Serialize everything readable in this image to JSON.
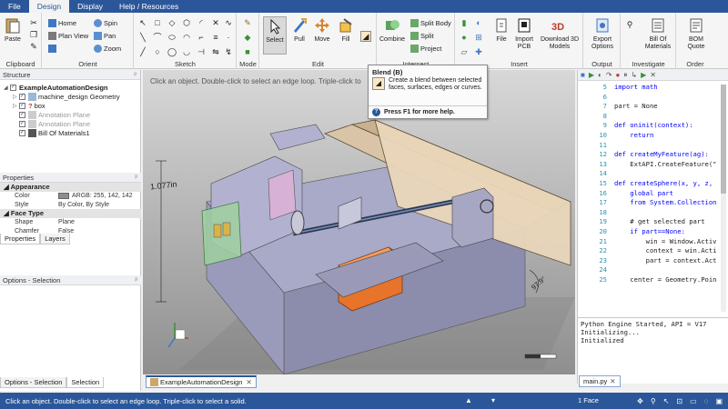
{
  "menu": [
    "File",
    "Design",
    "Display",
    "Help / Resources"
  ],
  "ribbon": {
    "clipboard": {
      "label": "Clipboard",
      "paste": "Paste"
    },
    "orient": {
      "label": "Orient",
      "home": "Home",
      "plan_view": "Plan View",
      "spin": "Spin",
      "pan": "Pan",
      "zoom": "Zoom"
    },
    "sketch": {
      "label": "Sketch"
    },
    "mode": {
      "label": "Mode"
    },
    "edit": {
      "label": "Edit",
      "select": "Select",
      "pull": "Pull",
      "move": "Move",
      "fill": "Fill"
    },
    "intersect": {
      "label": "Intersect",
      "combine": "Combine",
      "split_body": "Split Body",
      "split": "Split",
      "project": "Project"
    },
    "insert": {
      "label": "Insert",
      "file": "File",
      "import_pcb": "Import PCB",
      "download_3d": "Download 3D Models"
    },
    "output": {
      "label": "Output",
      "export_options": "Export Options"
    },
    "investigate": {
      "label": "Investigate",
      "bill_materials": "Bill Of Materials"
    },
    "order": {
      "label": "Order",
      "bom_quote": "BOM Quote"
    }
  },
  "structure": {
    "title": "Structure",
    "items": [
      {
        "label": "ExampleAutomationDesign",
        "bold": true
      },
      {
        "label": "machine_design Geometry"
      },
      {
        "label": "box"
      },
      {
        "label": "Annotation Plane"
      },
      {
        "label": "Annotation Plane"
      },
      {
        "label": "Bill Of Materials1"
      }
    ]
  },
  "properties": {
    "title": "Properties",
    "appearance": "Appearance",
    "color_k": "Color",
    "color_v": "ARGB: 255, 142, 142",
    "style_k": "Style",
    "style_v": "By Color, By Style",
    "face_type": "Face Type",
    "shape_k": "Shape",
    "shape_v": "Plane",
    "chamfer_k": "Chamfer",
    "chamfer_v": "False",
    "tab_properties": "Properties",
    "tab_layers": "Layers",
    "options_title": "Options - Selection",
    "btab_options": "Options - Selection",
    "btab_selection": "Selection"
  },
  "viewport": {
    "hint": "Click an object. Double-click to select an edge loop. Triple-click to",
    "dim_height": "1.077in",
    "dim_angle": "97.9°",
    "doc_tab": "ExampleAutomationDesign"
  },
  "tooltip": {
    "title": "Blend (B)",
    "desc": "Create a blend between selected faces, surfaces, edges or curves.",
    "help": "Press F1 for more help."
  },
  "code": {
    "lines": [
      {
        "n": "5",
        "t": "import math"
      },
      {
        "n": "6",
        "t": ""
      },
      {
        "n": "7",
        "t": "part = None"
      },
      {
        "n": "8",
        "t": ""
      },
      {
        "n": "9",
        "t": "def oninit(context):"
      },
      {
        "n": "10",
        "t": "    return"
      },
      {
        "n": "11",
        "t": ""
      },
      {
        "n": "12",
        "t": "def createMyFeature(ag):"
      },
      {
        "n": "13",
        "t": "    ExtAPI.CreateFeature(\""
      },
      {
        "n": "14",
        "t": ""
      },
      {
        "n": "15",
        "t": "def createSphere(x, y, z,"
      },
      {
        "n": "16",
        "t": "    global part"
      },
      {
        "n": "17",
        "t": "    from System.Collection"
      },
      {
        "n": "18",
        "t": ""
      },
      {
        "n": "19",
        "t": "    # get selected part"
      },
      {
        "n": "20",
        "t": "    if part==None:"
      },
      {
        "n": "21",
        "t": "        win = Window.Activ"
      },
      {
        "n": "22",
        "t": "        context = win.Acti"
      },
      {
        "n": "23",
        "t": "        part = context.Act"
      },
      {
        "n": "24",
        "t": ""
      },
      {
        "n": "25",
        "t": "    center = Geometry.Poin"
      }
    ],
    "console": [
      "Python Engine Started, API = V17",
      "Initializing...",
      "Initialized"
    ],
    "file_tab": "main.py"
  },
  "status": {
    "text": "Click an object. Double-click to select an edge loop. Triple-click to select a solid.",
    "selection": "1 Face"
  },
  "colors": {
    "accent": "#2b579a",
    "orange_part": "#e8732a",
    "panel_bg": "#d9c4a8"
  }
}
